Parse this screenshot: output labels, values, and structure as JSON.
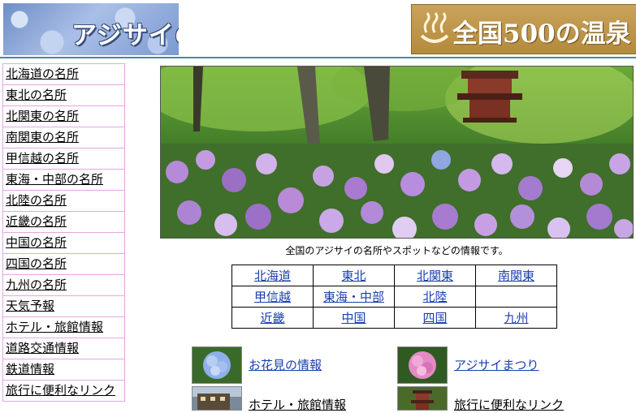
{
  "header": {
    "site_title": "アジサイの名所",
    "banner_text": "全国500の温泉",
    "banner_icon": "onsen-icon"
  },
  "sidebar": {
    "items": [
      {
        "label": "北海道の名所"
      },
      {
        "label": "東北の名所"
      },
      {
        "label": "北関東の名所"
      },
      {
        "label": "南関東の名所"
      },
      {
        "label": "甲信越の名所"
      },
      {
        "label": "東海・中部の名所"
      },
      {
        "label": "北陸の名所"
      },
      {
        "label": "近畿の名所"
      },
      {
        "label": "中国の名所"
      },
      {
        "label": "四国の名所"
      },
      {
        "label": "九州の名所"
      },
      {
        "label": "天気予報"
      },
      {
        "label": "ホテル・旅館情報"
      },
      {
        "label": "道路交通情報"
      },
      {
        "label": "鉄道情報"
      },
      {
        "label": "旅行に便利なリンク"
      }
    ]
  },
  "main": {
    "caption": "全国のアジサイの名所やスポットなどの情報です。",
    "regions": [
      [
        "北海道",
        "東北",
        "北関東",
        "南関東"
      ],
      [
        "甲信越",
        "東海・中部",
        "北陸",
        ""
      ],
      [
        "近畿",
        "中国",
        "四国",
        "九州"
      ]
    ],
    "features": [
      {
        "label": "お花見の情報",
        "icon": "blue-hydrangea-thumb"
      },
      {
        "label": "アジサイまつり",
        "icon": "pink-hydrangea-thumb"
      },
      {
        "label": "ホテル・旅館情報",
        "icon": "hotel-thumb"
      },
      {
        "label": "旅行に便利なリンク",
        "icon": "temple-thumb"
      }
    ]
  },
  "colors": {
    "link": "#1a3faf",
    "sidebar_border": "#e5a5e5",
    "header_rule": "#4a8a9a",
    "banner": "#c9a35a"
  }
}
